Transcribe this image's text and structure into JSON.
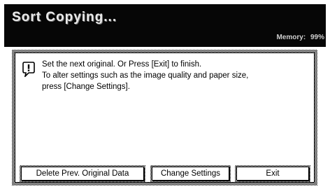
{
  "header": {
    "title": "Sort Copying...",
    "memory_label": "Memory",
    "memory_value": "99%"
  },
  "message": {
    "icon": "exclamation-icon",
    "lines": [
      "Set the next original. Or Press [Exit] to finish.",
      "To alter settings such as the image quality and paper size,",
      "press [Change Settings]."
    ]
  },
  "buttons": {
    "delete_prev": "Delete Prev. Original Data",
    "change_settings": "Change Settings",
    "exit": "Exit"
  }
}
